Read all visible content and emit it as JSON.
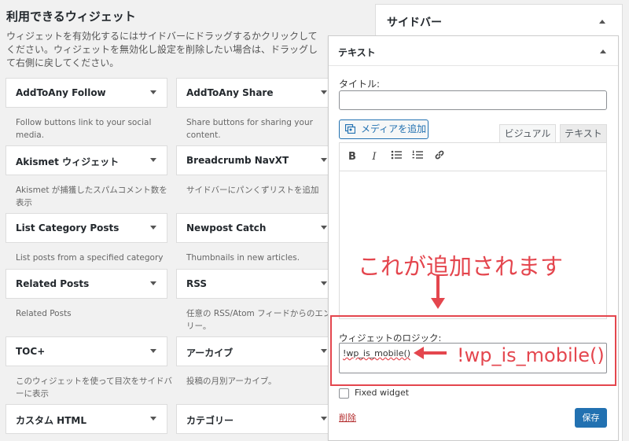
{
  "available": {
    "title": "利用できるウィジェット",
    "description": "ウィジェットを有効化するにはサイドバーにドラッグするかクリックしてください。ウィジェットを無効化し設定を削除したい場合は、ドラッグして右側に戻してください。",
    "widgets": [
      {
        "name": "AddToAny Follow",
        "desc": "Follow buttons link to your social media."
      },
      {
        "name": "AddToAny Share",
        "desc": "Share buttons for sharing your content."
      },
      {
        "name": "Akismet ウィジェット",
        "desc": "Akismet が捕獲したスパムコメント数を表示"
      },
      {
        "name": "Breadcrumb NavXT",
        "desc": "サイドバーにパンくずリストを追加"
      },
      {
        "name": "List Category Posts",
        "desc": "List posts from a specified category"
      },
      {
        "name": "Newpost Catch",
        "desc": "Thumbnails in new articles."
      },
      {
        "name": "Related Posts",
        "desc": "Related Posts"
      },
      {
        "name": "RSS",
        "desc": "任意の RSS/Atom フィードからのエントリー。"
      },
      {
        "name": "TOC+",
        "desc": "このウィジェットを使って目次をサイドバーに表示"
      },
      {
        "name": "アーカイブ",
        "desc": "投稿の月別アーカイブ。"
      },
      {
        "name": "カスタム HTML",
        "desc": ""
      },
      {
        "name": "カテゴリー",
        "desc": ""
      }
    ]
  },
  "sidebar": {
    "title": "サイドバー"
  },
  "text_widget": {
    "header": "テキスト",
    "title_label": "タイトル:",
    "title_value": "",
    "media_button": "メディアを追加",
    "tab_visual": "ビジュアル",
    "tab_text": "テキスト",
    "toolbar": {
      "bold": "B",
      "italic": "I"
    },
    "logic_label": "ウィジェットのロジック:",
    "logic_value": "!wp_is_mobile()",
    "fixed_widget_label": "Fixed widget",
    "delete_link": "削除",
    "save_button": "保存"
  },
  "annotation": {
    "headline": "これが追加されます",
    "code": "!wp_is_mobile()",
    "color": "#e4464e"
  }
}
